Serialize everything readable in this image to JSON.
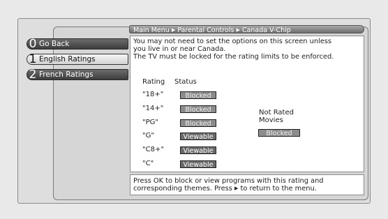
{
  "breadcrumb": {
    "items": [
      "Main Menu",
      "Parental Controls",
      "Canada V-Chip"
    ],
    "separator": "▶"
  },
  "menu": {
    "items": [
      {
        "number": "0",
        "label": "Go Back",
        "selected": false
      },
      {
        "number": "1",
        "label": "English Ratings",
        "selected": true
      },
      {
        "number": "2",
        "label": "French Ratings",
        "selected": false
      }
    ]
  },
  "message": {
    "line1": "You may not need to set the options on this screen unless",
    "line2": "you live in or near Canada.",
    "line3": "The TV must be locked for the rating limits to be enforced."
  },
  "table": {
    "headers": {
      "rating": "Rating",
      "status": "Status"
    },
    "rows": [
      {
        "rating": "\"18+\"",
        "status": "Blocked"
      },
      {
        "rating": "\"14+\"",
        "status": "Blocked"
      },
      {
        "rating": "\"PG\"",
        "status": "Blocked"
      },
      {
        "rating": "\"G\"",
        "status": "Viewable"
      },
      {
        "rating": "\"C8+\"",
        "status": "Viewable"
      },
      {
        "rating": "\"C\"",
        "status": "Viewable"
      }
    ]
  },
  "not_rated": {
    "label_line1": "Not Rated",
    "label_line2": "Movies",
    "status": "Blocked"
  },
  "help": {
    "line1": "Press OK to block or view programs with this rating and",
    "line2_part1": "corresponding themes. Press",
    "arrow": "▶",
    "line2_part2": "to return to the menu."
  }
}
